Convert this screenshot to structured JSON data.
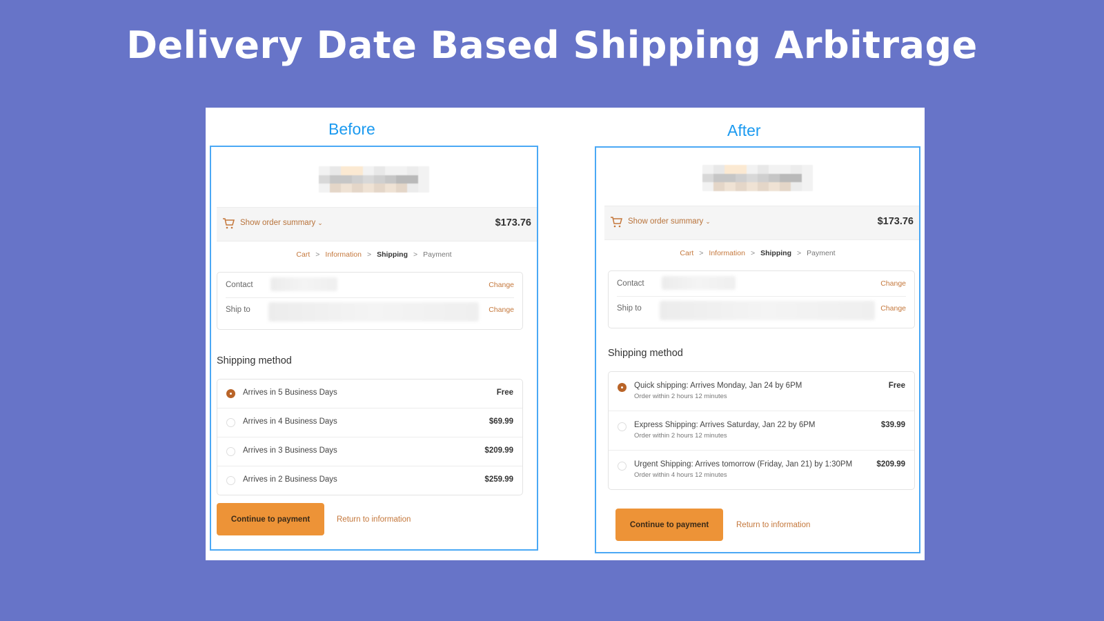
{
  "title": "Delivery Date Based Shipping Arbitrage",
  "colors": {
    "background": "#6774c8",
    "panel_border": "#4aa8f5",
    "label_blue": "#1b9af0",
    "accent_orange": "#ed9337",
    "link_brown": "#c4773b",
    "radio_checked": "#b96428"
  },
  "before": {
    "label": "Before",
    "summary": {
      "toggle_label": "Show order summary",
      "chevron_icon": "chevron-down-icon",
      "cart_icon": "cart-icon",
      "total": "$173.76"
    },
    "breadcrumb": [
      {
        "label": "Cart",
        "state": "link"
      },
      {
        "label": "Information",
        "state": "link"
      },
      {
        "label": "Shipping",
        "state": "current"
      },
      {
        "label": "Payment",
        "state": "upcoming"
      }
    ],
    "breadcrumb_separator": ">",
    "contact": {
      "label": "Contact",
      "change": "Change"
    },
    "ship_to": {
      "label": "Ship to",
      "change": "Change"
    },
    "section_title": "Shipping method",
    "methods": [
      {
        "label": "Arrives in 5 Business Days",
        "price": "Free",
        "selected": true
      },
      {
        "label": "Arrives in 4 Business Days",
        "price": "$69.99",
        "selected": false
      },
      {
        "label": "Arrives in 3 Business Days",
        "price": "$209.99",
        "selected": false
      },
      {
        "label": "Arrives in 2 Business Days",
        "price": "$259.99",
        "selected": false
      }
    ],
    "continue_button": "Continue to payment",
    "return_link": "Return to information"
  },
  "after": {
    "label": "After",
    "summary": {
      "toggle_label": "Show order summary",
      "chevron_icon": "chevron-down-icon",
      "cart_icon": "cart-icon",
      "total": "$173.76"
    },
    "breadcrumb": [
      {
        "label": "Cart",
        "state": "link"
      },
      {
        "label": "Information",
        "state": "link"
      },
      {
        "label": "Shipping",
        "state": "current"
      },
      {
        "label": "Payment",
        "state": "upcoming"
      }
    ],
    "breadcrumb_separator": ">",
    "contact": {
      "label": "Contact",
      "change": "Change"
    },
    "ship_to": {
      "label": "Ship to",
      "change": "Change"
    },
    "section_title": "Shipping method",
    "methods": [
      {
        "label": "Quick shipping: Arrives Monday, Jan 24 by 6PM",
        "sub": "Order within 2 hours 12 minutes",
        "price": "Free",
        "selected": true
      },
      {
        "label": "Express Shipping: Arrives Saturday, Jan 22 by 6PM",
        "sub": "Order within 2 hours 12 minutes",
        "price": "$39.99",
        "selected": false
      },
      {
        "label": "Urgent Shipping: Arrives tomorrow (Friday, Jan 21) by 1:30PM",
        "sub": "Order within 4 hours 12 minutes",
        "price": "$209.99",
        "selected": false
      }
    ],
    "continue_button": "Continue to payment",
    "return_link": "Return to information"
  }
}
